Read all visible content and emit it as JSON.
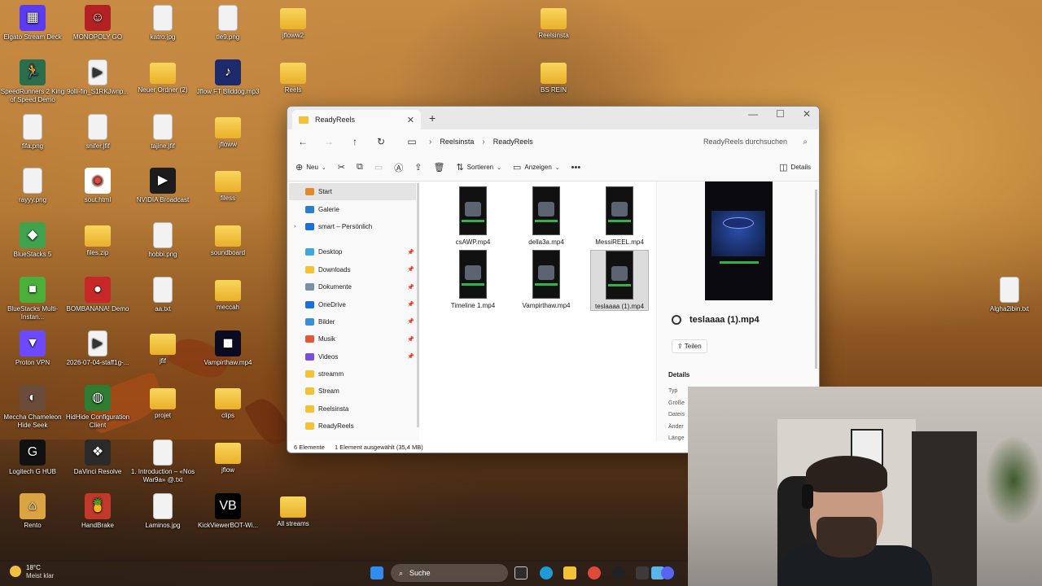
{
  "desktop": {
    "icons": [
      {
        "label": "Elgato Stream Deck",
        "kind": "app",
        "color": "#5b3cf0",
        "glyph": "▦"
      },
      {
        "label": "MONOPOLY GO",
        "kind": "app",
        "color": "#b22222",
        "glyph": "☺"
      },
      {
        "label": "katro.jpg",
        "kind": "file"
      },
      {
        "label": "tle9.png",
        "kind": "file"
      },
      {
        "label": "jfloww2",
        "kind": "folder"
      },
      {
        "label": "SpeedRunners 2 King of Speed Demo",
        "kind": "app",
        "color": "#2b6e4e",
        "glyph": "🏃"
      },
      {
        "label": "9olli-fin_S1RKJwnp...",
        "kind": "file",
        "glyph": "▶"
      },
      {
        "label": "Neuer Ordner (2)",
        "kind": "folder"
      },
      {
        "label": "Jflow FT Bliddog.mp3",
        "kind": "app",
        "color": "#1d2a6b",
        "glyph": "♪"
      },
      {
        "label": "Reels",
        "kind": "folder"
      },
      {
        "label": "fifa.png",
        "kind": "file"
      },
      {
        "label": "snifer.jfif",
        "kind": "file"
      },
      {
        "label": "tajine.jfif",
        "kind": "file"
      },
      {
        "label": "jfloww",
        "kind": "folder"
      },
      {
        "label": "rayyy.png",
        "kind": "file"
      },
      {
        "label": "sout.html",
        "kind": "app",
        "color": "#ffffff",
        "glyph": "◉"
      },
      {
        "label": "NVIDIA Broadcast",
        "kind": "app",
        "color": "#1c1c1c",
        "glyph": "▶"
      },
      {
        "label": "filess",
        "kind": "folder"
      },
      {
        "label": "BlueStacks 5",
        "kind": "app",
        "color": "#3fa34d",
        "glyph": "◆"
      },
      {
        "label": "files.zip",
        "kind": "folder"
      },
      {
        "label": "hobbi.png",
        "kind": "file"
      },
      {
        "label": "soundboard",
        "kind": "folder"
      },
      {
        "label": "BlueStacks Multi-Instan...",
        "kind": "app",
        "color": "#4caf3b",
        "glyph": "■"
      },
      {
        "label": "BOMBANANA! Demo",
        "kind": "app",
        "color": "#c62828",
        "glyph": "●"
      },
      {
        "label": "aa.txt",
        "kind": "file"
      },
      {
        "label": "meccah",
        "kind": "folder"
      },
      {
        "label": "Proton VPN",
        "kind": "app",
        "color": "#6d4aff",
        "glyph": "▼"
      },
      {
        "label": "2026-07-04-staff1g-...",
        "kind": "file",
        "glyph": "▶"
      },
      {
        "label": "jfif",
        "kind": "folder"
      },
      {
        "label": "Vampirthaw.mp4",
        "kind": "app",
        "color": "#0a0a20",
        "glyph": "◼"
      },
      {
        "label": "Meccha Chameleon Hide Seek",
        "kind": "app",
        "color": "#6b4b3a",
        "glyph": "◐"
      },
      {
        "label": "HidHide Configuration Client",
        "kind": "app",
        "color": "#2e7d32",
        "glyph": "◍"
      },
      {
        "label": "projet",
        "kind": "folder"
      },
      {
        "label": "clips",
        "kind": "folder"
      },
      {
        "label": "Logitech G HUB",
        "kind": "app",
        "color": "#111111",
        "glyph": "G"
      },
      {
        "label": "DaVinci Resolve",
        "kind": "app",
        "color": "#2a2a2a",
        "glyph": "❖"
      },
      {
        "label": "1. Introduction – «Nos War9a» @.txt",
        "kind": "file"
      },
      {
        "label": "jflow",
        "kind": "folder"
      },
      {
        "label": "Rento",
        "kind": "app",
        "color": "#d9a441",
        "glyph": "⌂"
      },
      {
        "label": "HandBrake",
        "kind": "app",
        "color": "#c0392b",
        "glyph": "🍍"
      },
      {
        "label": "Laminos.jpg",
        "kind": "file"
      },
      {
        "label": "KickViewerBOT-Wi...",
        "kind": "app",
        "color": "#000000",
        "glyph": "VB"
      },
      {
        "label": "All streams",
        "kind": "folder"
      },
      {
        "label": "Reelsinsta",
        "kind": "folder"
      },
      {
        "label": "BS REIN",
        "kind": "folder"
      },
      {
        "label": "Algha2ibin.txt",
        "kind": "file"
      }
    ]
  },
  "explorer": {
    "tab_title": "ReadyReels",
    "tab_close": "✕",
    "new_tab": "+",
    "window_controls": {
      "minimize": "—",
      "maximize": "☐",
      "close": "✕"
    },
    "nav": {
      "back": "←",
      "forward": "→",
      "up": "↑",
      "refresh": "↻",
      "pc": "▭"
    },
    "breadcrumb": [
      "Reelsinsta",
      "ReadyReels"
    ],
    "breadcrumb_sep": "›",
    "search_placeholder": "ReadyReels durchsuchen",
    "toolbar": {
      "new": "Neu",
      "sort": "Sortieren",
      "view": "Anzeigen",
      "more": "•••",
      "details": "Details"
    },
    "sidebar": [
      {
        "label": "Start",
        "icon": "home-icon",
        "color": "#e08a2c",
        "selected": true
      },
      {
        "label": "Galerie",
        "icon": "gallery-icon",
        "color": "#2d7dd2"
      },
      {
        "label": "smart – Persönlich",
        "icon": "onedrive-icon",
        "color": "#1f6fd1",
        "expandable": true
      },
      {
        "label": "Desktop",
        "icon": "desktop-icon",
        "color": "#3fa7e0",
        "pinned": true
      },
      {
        "label": "Downloads",
        "icon": "downloads-icon",
        "color": "#f2c337",
        "pinned": true
      },
      {
        "label": "Dokumente",
        "icon": "documents-icon",
        "color": "#7b8fa6",
        "pinned": true
      },
      {
        "label": "OneDrive",
        "icon": "cloud-icon",
        "color": "#1f6fd1",
        "pinned": true
      },
      {
        "label": "Bilder",
        "icon": "pictures-icon",
        "color": "#3b8fd8",
        "pinned": true
      },
      {
        "label": "Musik",
        "icon": "music-icon",
        "color": "#e3563a",
        "pinned": true
      },
      {
        "label": "Videos",
        "icon": "videos-icon",
        "color": "#7a4fd8",
        "pinned": true
      },
      {
        "label": "streamm",
        "icon": "folder-icon",
        "color": "#f2c337"
      },
      {
        "label": "Stream",
        "icon": "folder-icon",
        "color": "#f2c337"
      },
      {
        "label": "Reelsinsta",
        "icon": "folder-icon",
        "color": "#f2c337"
      },
      {
        "label": "ReadyReels",
        "icon": "folder-icon",
        "color": "#f2c337"
      }
    ],
    "pin_glyph": "📌",
    "files": [
      {
        "name": "csAWP.mp4"
      },
      {
        "name": "della3a.mp4"
      },
      {
        "name": "MessiREEL.mp4"
      },
      {
        "name": "Timeline 1.mp4"
      },
      {
        "name": "Vampirthaw.mp4"
      },
      {
        "name": "teslaaaa (1).mp4",
        "selected": true
      }
    ],
    "details_pane": {
      "file_name": "teslaaaa (1).mp4",
      "share": "Teilen",
      "section": "Details",
      "rows": [
        "Typ",
        "Größe",
        "Dateis",
        "Änder",
        "Länge"
      ]
    },
    "status": {
      "count": "6 Elemente",
      "selection": "1 Element ausgewählt (35,4 MB)"
    }
  },
  "taskbar": {
    "temperature": "18°C",
    "condition": "Meist klar",
    "search": "Suche"
  }
}
